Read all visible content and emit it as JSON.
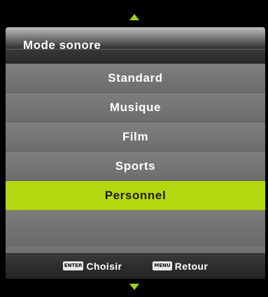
{
  "nav": {
    "up_icon": "arrow-up-icon",
    "down_icon": "arrow-down-icon",
    "arrow_color": "#9ed21a"
  },
  "menu": {
    "title": "Mode sonore",
    "items": [
      {
        "label": "Standard",
        "selected": false
      },
      {
        "label": "Musique",
        "selected": false
      },
      {
        "label": "Film",
        "selected": false
      },
      {
        "label": "Sports",
        "selected": false
      },
      {
        "label": "Personnel",
        "selected": true
      }
    ],
    "selected_color": "#b4d80f"
  },
  "footer": {
    "enter_key": "ENTER",
    "enter_label": "Choisir",
    "menu_key": "MENU",
    "menu_label": "Retour"
  }
}
